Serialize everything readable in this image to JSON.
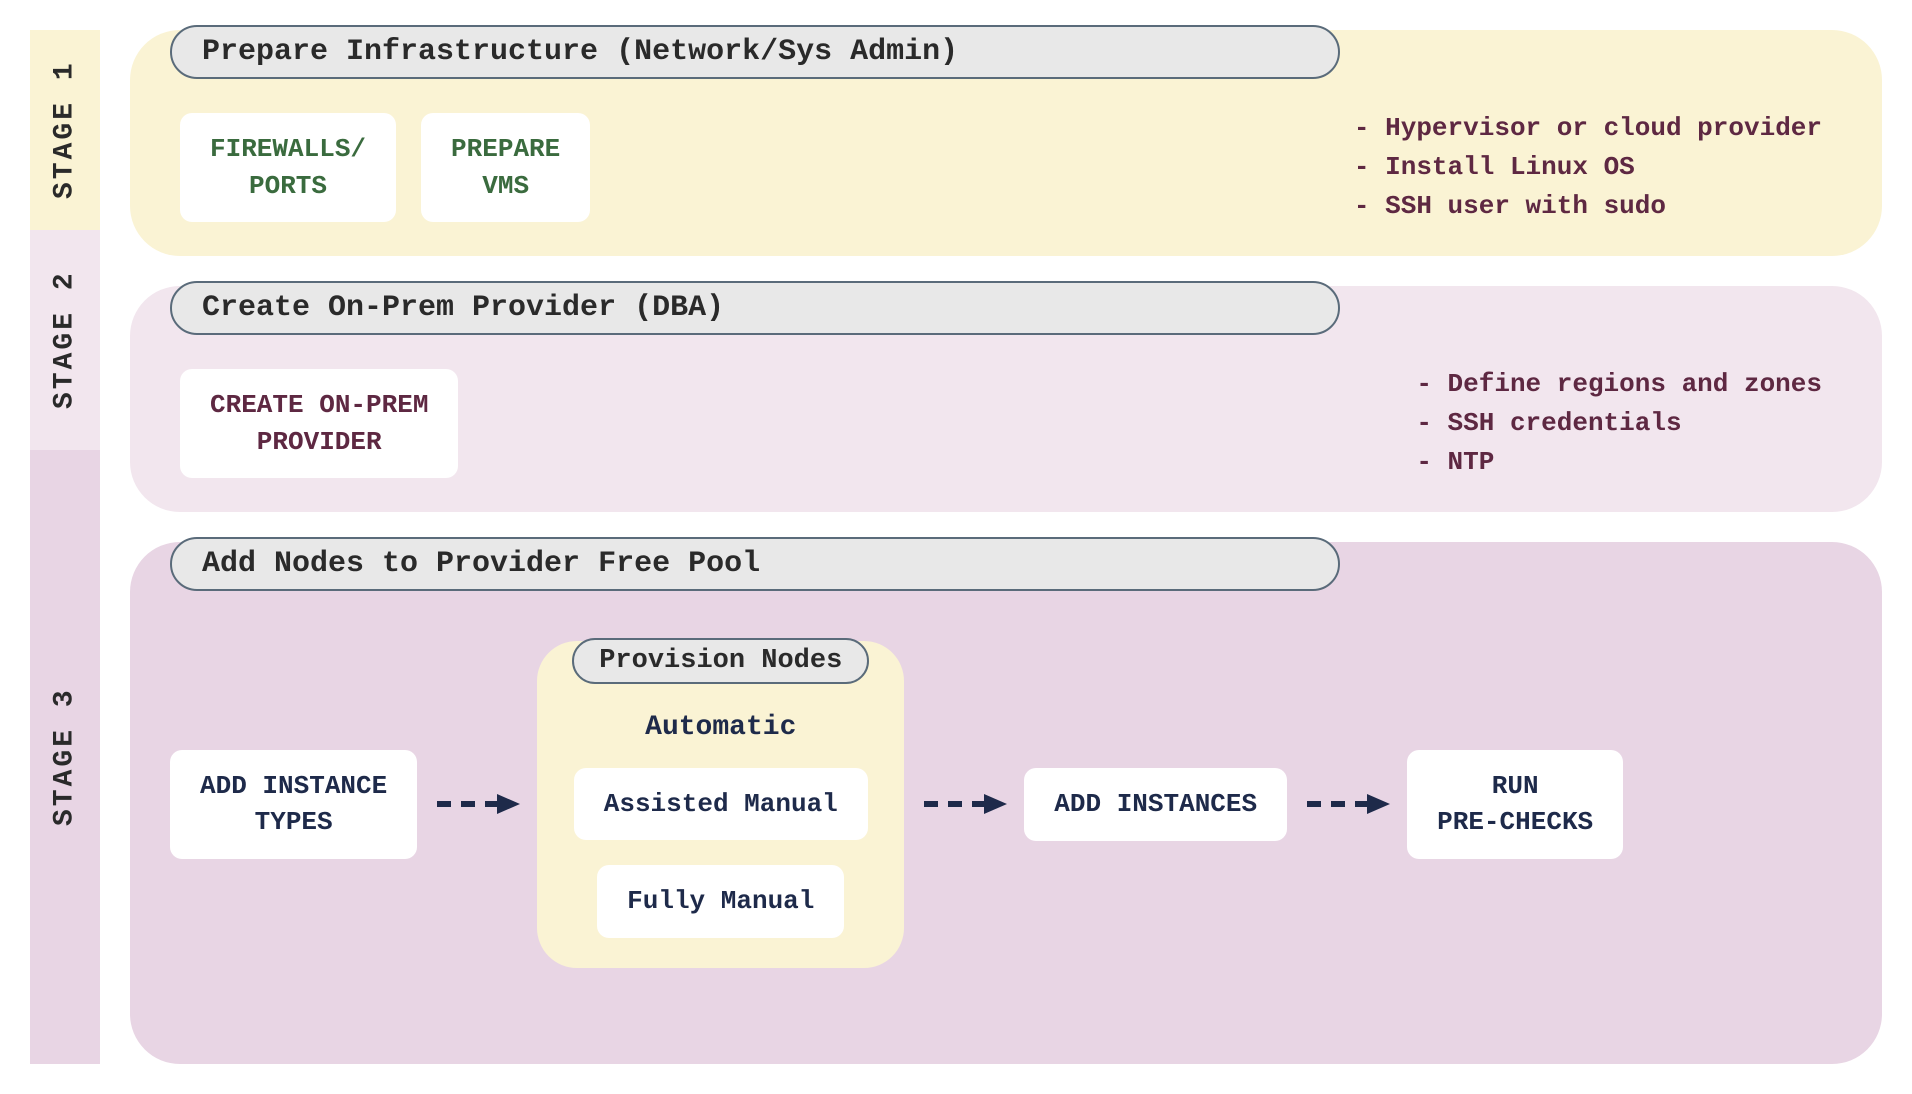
{
  "stages": {
    "s1": {
      "label": "STAGE 1",
      "header": "Prepare Infrastructure (Network/Sys Admin)",
      "box1": "FIREWALLS/\nPORTS",
      "box2": "PREPARE\nVMS",
      "notes": "- Hypervisor or cloud provider\n- Install Linux OS\n- SSH user with sudo"
    },
    "s2": {
      "label": "STAGE 2",
      "header": "Create On-Prem Provider (DBA)",
      "box1": "CREATE ON-PREM\nPROVIDER",
      "notes": "- Define regions and zones\n- SSH credentials\n- NTP"
    },
    "s3": {
      "label": "STAGE 3",
      "header": "Add Nodes to Provider Free Pool",
      "box1": "ADD INSTANCE\nTYPES",
      "provision": {
        "header": "Provision Nodes",
        "automatic": "Automatic",
        "assisted": "Assisted Manual",
        "fully": "Fully Manual"
      },
      "box2": "ADD INSTANCES",
      "box3": "RUN\nPRE-CHECKS"
    }
  }
}
